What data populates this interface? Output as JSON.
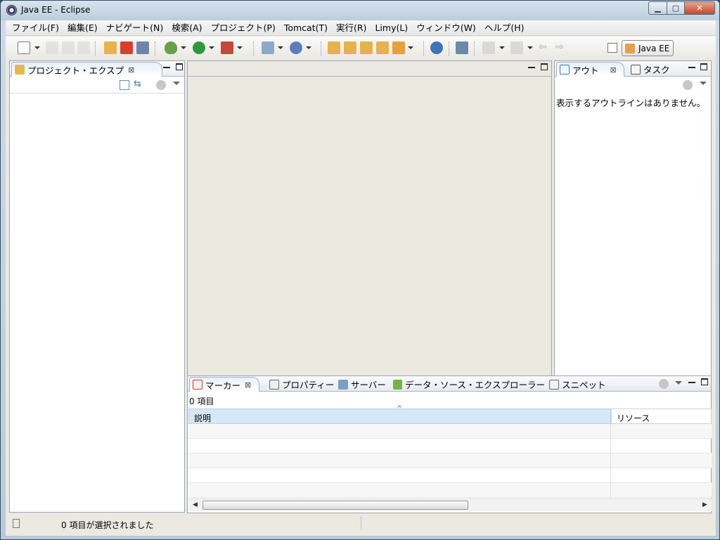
{
  "window": {
    "title": "Java EE - Eclipse"
  },
  "menu": [
    "ファイル(F)",
    "編集(E)",
    "ナビゲート(N)",
    "検索(A)",
    "プロジェクト(P)",
    "Tomcat(T)",
    "実行(R)",
    "Limy(L)",
    "ウィンドウ(W)",
    "ヘルプ(H)"
  ],
  "perspective": {
    "label": "Java EE"
  },
  "project_explorer": {
    "tab": "プロジェクト・エクスプ"
  },
  "outline": {
    "tab_outline": "アウト",
    "tab_tasks": "タスク",
    "empty_message": "表示するアウトラインはありません。"
  },
  "bottom": {
    "tabs": [
      "マーカー",
      "プロパティー",
      "サーバー",
      "データ・ソース・エクスプローラー",
      "スニペット"
    ],
    "item_count": "0 項目",
    "columns": [
      "説明",
      "リソース"
    ],
    "sort_indicator": "^"
  },
  "status": {
    "text": "0 項目が選択されました"
  },
  "colors": {
    "accent": "#3d7ab8",
    "panel_border": "#99a6b5",
    "selected_header": "#d6e8f6"
  }
}
